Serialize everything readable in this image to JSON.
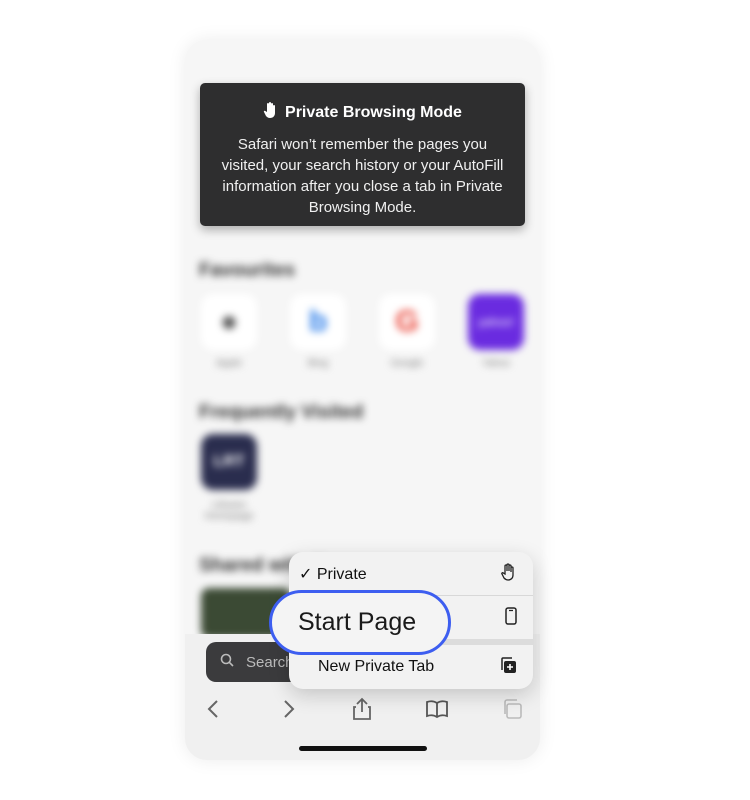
{
  "banner": {
    "title": "Private Browsing Mode",
    "body": "Safari won’t remember the pages you visited, your search history or your AutoFill information after you close a tab in Private Browsing Mode."
  },
  "start_page": {
    "favourites_title": "Favourites",
    "favourites": [
      {
        "label": "Apple",
        "icon": "apple-icon"
      },
      {
        "label": "Bing",
        "icon": "bing-icon"
      },
      {
        "label": "Google",
        "icon": "google-icon"
      },
      {
        "label": "Yahoo",
        "icon": "yahoo-icon"
      }
    ],
    "frequently_visited_title": "Frequently Visited",
    "frequent_tile_text": "LRT",
    "frequent_label": "Lifewire Homepage",
    "shared_title": "Shared with You"
  },
  "search": {
    "placeholder": "Search"
  },
  "menu": {
    "items": [
      {
        "label": "Private",
        "checked": true,
        "icon": "hand-icon"
      },
      {
        "label": "Start Page",
        "icon": "phone-icon"
      },
      {
        "label": "New Private Tab",
        "icon": "new-tab-icon"
      }
    ],
    "check_mark": "✓"
  },
  "colors": {
    "highlight_border": "#3d5ef0",
    "banner_bg": "#2e2e2f"
  }
}
